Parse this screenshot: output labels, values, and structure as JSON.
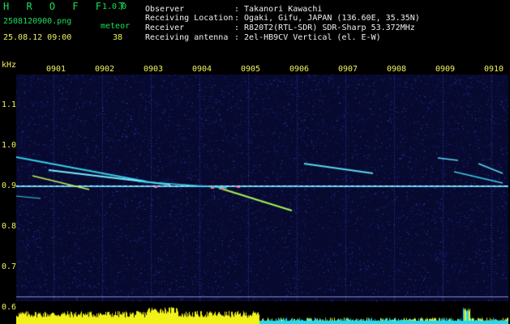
{
  "header": {
    "app_name": "H R O F F T",
    "version": "1.0.0",
    "filename": "2508120900.png",
    "meteor_label": "meteor",
    "datetime": "25.08.12 09:00",
    "meteor_count": "38",
    "info_labels": [
      "Observer",
      "Receiving Location",
      "Receiver",
      "Receiving antenna"
    ],
    "info_values": [
      ": Takanori Kawachi",
      ": Ogaki, Gifu, JAPAN (136.60E, 35.35N)",
      ": R820T2(RTL-SDR) SDR-Sharp 53.372MHz",
      ": 2el-HB9CV Vertical (el. E-W)"
    ]
  },
  "axis": {
    "unit": "kHz",
    "y_ticks": [
      "1.1",
      "1.0",
      "0.9",
      "0.8",
      "0.7",
      "0.6"
    ],
    "x_ticks": [
      "0901",
      "0902",
      "0903",
      "0904",
      "0905",
      "0906",
      "0907",
      "0908",
      "0909",
      "0910"
    ]
  },
  "colors": {
    "background": "#000000",
    "noise": "#1b2a8a",
    "text_green": "#19e05a",
    "text_yellow": "#f2f25a",
    "trace": "#3ad0e8",
    "level_bar": "#f2f21a",
    "level_baseline": "#2ad8ee"
  }
}
